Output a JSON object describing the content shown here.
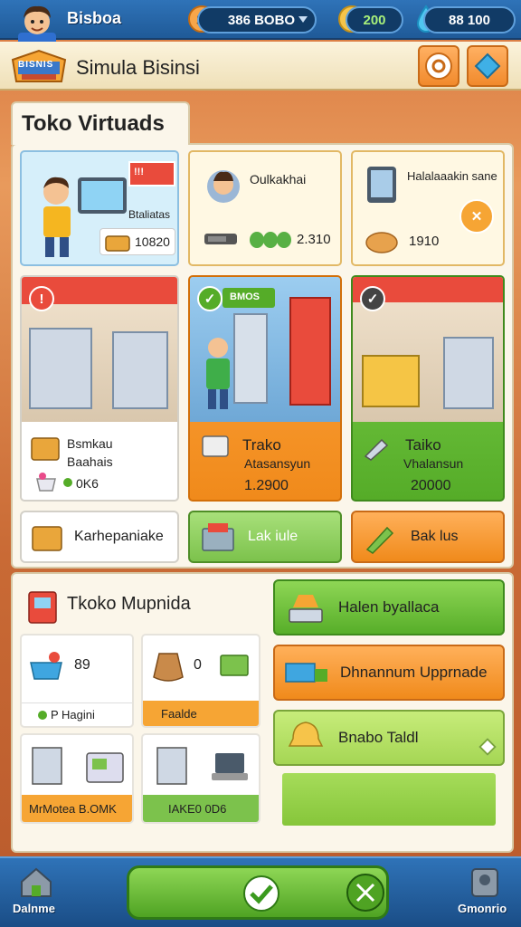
{
  "header": {
    "player_name": "Bisboa",
    "coins": "386 BOBO",
    "gems": "200",
    "energy": "88 100"
  },
  "subheader": {
    "logo_text": "BISNIS",
    "title": "Simula Bisinsi"
  },
  "shop": {
    "section_title": "Toko Virtuads",
    "stats": [
      {
        "label": "Btaliatas",
        "badge": "!!!",
        "value": "10820"
      },
      {
        "label": "Oulkakhai",
        "value": "2.310"
      },
      {
        "label": "Halalaaakin sane",
        "value": "1910"
      }
    ],
    "stores": [
      {
        "name": "Bsmkau",
        "sub": "Baahais",
        "meta": "0K6",
        "banner": ""
      },
      {
        "name": "Trako",
        "sub": "Atasansyun",
        "price": "1.2900",
        "banner": "BMOS"
      },
      {
        "name": "Taiko",
        "sub": "Vhalansun",
        "price": "20000",
        "banner": ""
      }
    ],
    "actions": [
      {
        "label": "Karhepaniake"
      },
      {
        "label": "Lak iule"
      },
      {
        "label": "Bak lus"
      }
    ]
  },
  "upgrade": {
    "title": "Tkoko Mupnida",
    "counts": [
      {
        "value": "89"
      },
      {
        "value": "0"
      }
    ],
    "tags": [
      {
        "label": "P Hagini"
      },
      {
        "label": "Faalde"
      }
    ],
    "bottom_tags": [
      {
        "label": "MrMotea B.OMK"
      },
      {
        "label": "IAKE0 0D6"
      }
    ],
    "buttons": [
      {
        "label": "Halen byallaca"
      },
      {
        "label": "Dhnannum Upprnade"
      },
      {
        "label": "Bnabo Taldl"
      }
    ]
  },
  "nav": {
    "left_label": "Dalnme",
    "right_label": "Gmonrio"
  },
  "colors": {
    "topbar": "#2f73b8",
    "accent_orange": "#f08a1b",
    "accent_green": "#55ac28",
    "panel": "#fbf6ea"
  }
}
